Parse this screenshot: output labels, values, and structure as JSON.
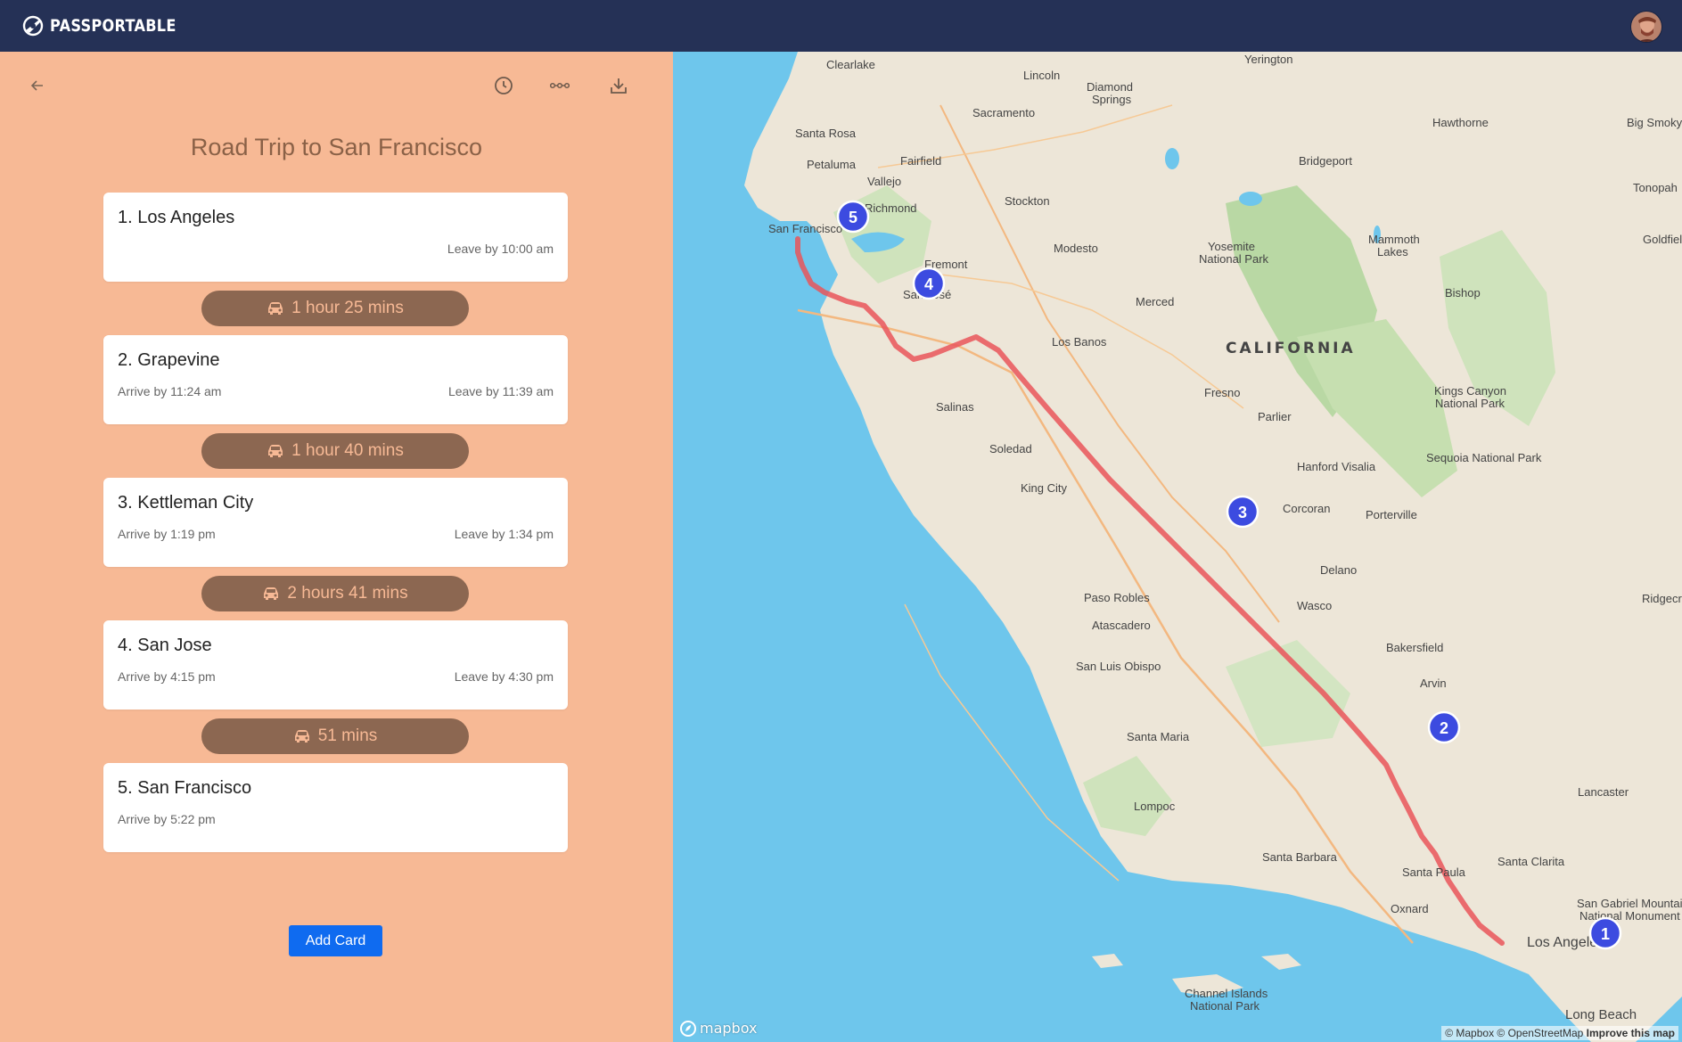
{
  "app": {
    "brand": "PASSPORTABLE"
  },
  "trip": {
    "title": "Road Trip to San Francisco",
    "stops": [
      {
        "title": "1. Los Angeles",
        "arrive": "",
        "leave": "Leave by 10:00 am"
      },
      {
        "title": "2. Grapevine",
        "arrive": "Arrive by 11:24 am",
        "leave": "Leave by 11:39 am"
      },
      {
        "title": "3. Kettleman City",
        "arrive": "Arrive by 1:19 pm",
        "leave": "Leave by 1:34 pm"
      },
      {
        "title": "4. San Jose",
        "arrive": "Arrive by 4:15 pm",
        "leave": "Leave by 4:30 pm"
      },
      {
        "title": "5. San Francisco",
        "arrive": "Arrive by 5:22 pm",
        "leave": ""
      }
    ],
    "legs": [
      {
        "duration": "1 hour 25 mins"
      },
      {
        "duration": "1 hour 40 mins"
      },
      {
        "duration": "2 hours 41 mins"
      },
      {
        "duration": "51 mins"
      }
    ],
    "add_card_label": "Add Card"
  },
  "map": {
    "region_label": "CALIFORNIA",
    "markers": [
      "1",
      "2",
      "3",
      "4",
      "5"
    ],
    "places": [
      "Yerington",
      "Clearlake",
      "Lincoln",
      "Diamond Springs",
      "Sacramento",
      "Hawthorne",
      "Big Smoky Valley",
      "Santa Rosa",
      "Fairfield",
      "Petaluma",
      "Vallejo",
      "Bridgeport",
      "Tonopah",
      "Stockton",
      "San Francisco",
      "Richmond",
      "Fremont",
      "Modesto",
      "Yosemite National Park",
      "Mammoth Lakes",
      "Goldfield",
      "San José",
      "Bishop",
      "Merced",
      "Los Banos",
      "Salinas",
      "Fresno",
      "Parlier",
      "Kings Canyon National Park",
      "Hanford",
      "Visalia",
      "Soledad",
      "Sequoia National Park",
      "King City",
      "Corcoran",
      "Porterville",
      "Delano",
      "Ridgecrest",
      "Paso Robles",
      "Wasco",
      "Atascadero",
      "Bakersfield",
      "San Luis Obispo",
      "Arvin",
      "Santa Maria",
      "Lancaster",
      "Lompoc",
      "Santa Barbara",
      "Santa Clarita",
      "Santa Paula",
      "Oxnard",
      "San Gabriel Mountains National Monument",
      "Los Angeles",
      "Channel Islands National Park",
      "Long Beach"
    ],
    "attribution": "© Mapbox © OpenStreetMap",
    "improve_link": "Improve this map",
    "logo_text": "mapbox"
  },
  "icons": {
    "back": "arrow-left-icon",
    "history": "clock-icon",
    "more": "ellipsis-icon",
    "download": "download-icon",
    "car": "car-icon"
  }
}
